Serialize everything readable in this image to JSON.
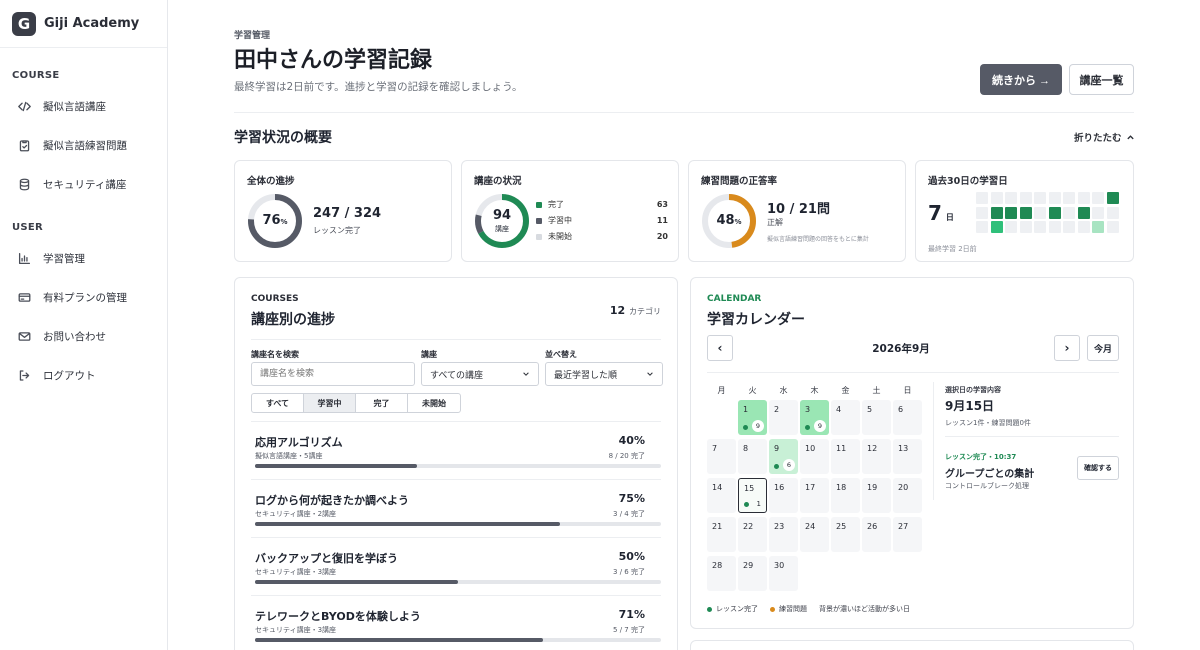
{
  "brand": {
    "logo_letter": "G",
    "name": "Giji Academy"
  },
  "sidebar": {
    "sections": [
      {
        "title": "COURSE",
        "items": [
          {
            "label": "擬似言語講座",
            "icon": "code-icon"
          },
          {
            "label": "擬似言語練習問題",
            "icon": "clipboard-check-icon"
          },
          {
            "label": "セキュリティ講座",
            "icon": "database-icon"
          }
        ]
      },
      {
        "title": "USER",
        "items": [
          {
            "label": "学習管理",
            "icon": "bar-chart-icon"
          },
          {
            "label": "有料プランの管理",
            "icon": "credit-card-icon"
          },
          {
            "label": "お問い合わせ",
            "icon": "mail-icon"
          },
          {
            "label": "ログアウト",
            "icon": "logout-icon"
          }
        ]
      }
    ]
  },
  "header": {
    "pre_title": "学習管理",
    "title": "田中さんの学習記録",
    "subtitle": "最終学習は2日前です。進捗と学習の記録を確認しましょう。",
    "continue_label": "続きから →",
    "courses_label": "講座一覧"
  },
  "overview": {
    "title": "学習状況の概要",
    "collapse_label": "折りたたむ",
    "progress": {
      "label": "全体の進捗",
      "percent": 76,
      "percent_text": "76",
      "percent_unit": "%",
      "count": "247 / 324",
      "count_label": "レッスン完了"
    },
    "status": {
      "label": "講座の状況",
      "total": "94",
      "total_label": "講座",
      "items": [
        {
          "label": "完了",
          "count": "63",
          "color": "#1f8a54"
        },
        {
          "label": "学習中",
          "count": "11",
          "color": "#565a66"
        },
        {
          "label": "未開始",
          "count": "20",
          "color": "#d8dbe0"
        }
      ]
    },
    "accuracy": {
      "label": "練習問題の正答率",
      "percent": 48,
      "percent_text": "48",
      "percent_unit": "%",
      "score": "10 / 21問",
      "score_label": "正解",
      "note": "擬似言語練習問題の回答をもとに集計"
    },
    "last30": {
      "label": "過去30日の学習日",
      "days": "7",
      "days_unit": "日",
      "note": "最終学習 2日前",
      "heat": [
        0,
        0,
        0,
        0,
        0,
        0,
        0,
        0,
        0,
        1,
        0,
        1,
        1,
        1,
        0,
        1,
        0,
        1,
        0,
        0,
        0,
        2,
        0,
        0,
        0,
        0,
        0,
        0,
        3,
        0
      ]
    }
  },
  "courses": {
    "eyebrow": "COURSES",
    "title": "講座別の進捗",
    "count": "12",
    "count_unit": "カテゴリ",
    "search_label": "講座名を検索",
    "search_placeholder": "講座名を検索",
    "course_filter_label": "講座",
    "course_filter_value": "すべての講座",
    "sort_label": "並べ替え",
    "sort_value": "最近学習した順",
    "tabs": [
      "すべて",
      "学習中",
      "完了",
      "未開始"
    ],
    "active_tab": 1,
    "items": [
      {
        "name": "応用アルゴリズム",
        "sub": "擬似言語講座・5講座",
        "pct_text": "40%",
        "progress": 0.4,
        "count": "8 / 20 完了"
      },
      {
        "name": "ログから何が起きたか調べよう",
        "sub": "セキュリティ講座・2講座",
        "pct_text": "75%",
        "progress": 0.75,
        "count": "3 / 4 完了"
      },
      {
        "name": "バックアップと復旧を学ぼう",
        "sub": "セキュリティ講座・3講座",
        "pct_text": "50%",
        "progress": 0.5,
        "count": "3 / 6 完了"
      },
      {
        "name": "テレワークとBYODを体験しよう",
        "sub": "セキュリティ講座・3講座",
        "pct_text": "71%",
        "progress": 0.71,
        "count": "5 / 7 完了"
      }
    ]
  },
  "calendar": {
    "eyebrow": "CALENDAR",
    "title": "学習カレンダー",
    "month": "2026年9月",
    "prev": "‹",
    "next": "›",
    "today_label": "今月",
    "weekdays": [
      "月",
      "火",
      "水",
      "木",
      "金",
      "土",
      "日"
    ],
    "start_offset": 1,
    "days_in_month": 30,
    "activity": {
      "1": {
        "level": 2,
        "dot": true,
        "count": "9"
      },
      "3": {
        "level": 2,
        "dot": true,
        "count": "9"
      },
      "9": {
        "level": 1,
        "dot": true,
        "count": "6"
      },
      "15": {
        "level": 0,
        "today": true,
        "dot": true,
        "count_plain": "1"
      }
    },
    "selected_label": "選択日の学習内容",
    "selected_date": "9月15日",
    "selected_summary": "レッスン1件・練習問題0件",
    "activity_tag": "レッスン完了・10:37",
    "activity_title": "グループごとの集計",
    "activity_sub": "コントロールブレーク処理",
    "confirm_label": "確認する",
    "legend_lesson": "レッスン完了",
    "legend_practice": "練習問題",
    "legend_note": "背景が濃いほど活動が多い日",
    "colors": {
      "lesson": "#1f8a54",
      "practice": "#d98a1c"
    }
  }
}
